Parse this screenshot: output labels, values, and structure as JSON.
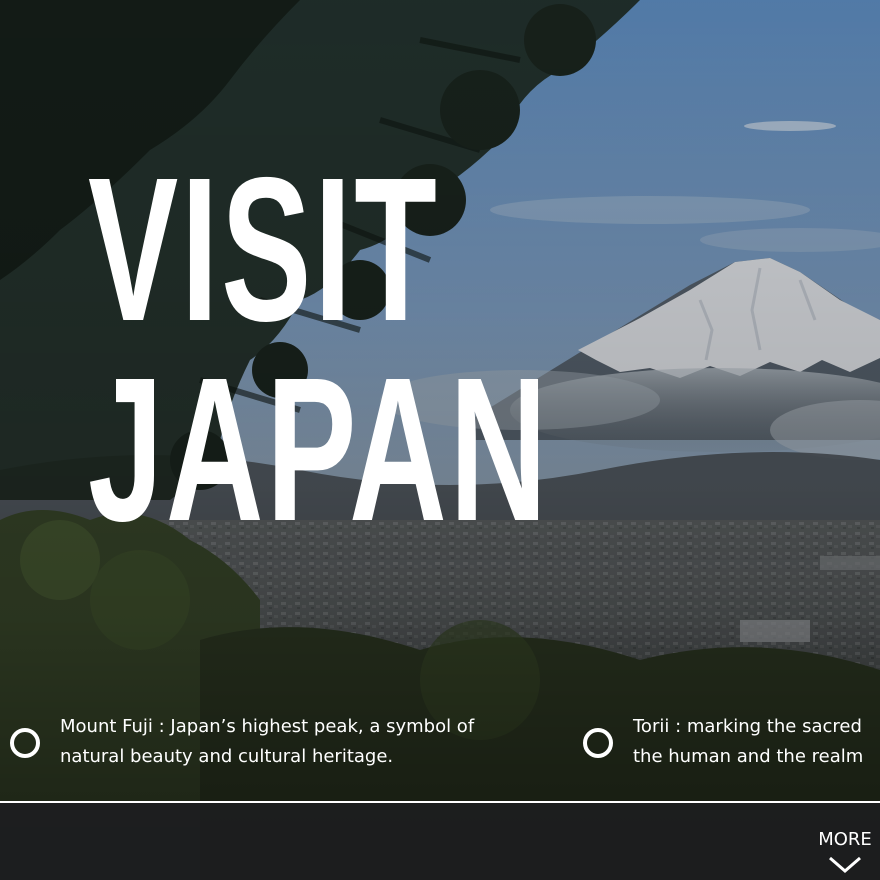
{
  "hero": {
    "headline_line1": "VISIT",
    "headline_line2": "JAPAN"
  },
  "facts": [
    {
      "icon": "circle-icon",
      "line1": "Mount Fuji : Japan’s highest peak, a symbol of",
      "line2": "natural beauty and cultural heritage."
    },
    {
      "icon": "circle-icon",
      "line1": "Torii : marking the sacred",
      "line2": "the human and the realm"
    }
  ],
  "more": {
    "label": "MORE",
    "icon": "chevron-down-icon"
  },
  "colors": {
    "text": "#ffffff",
    "footer_band": "#1d1e20",
    "sky_top": "#6e9ac9",
    "sky_mid": "#9cb5cf",
    "snow": "#eef1f6"
  }
}
